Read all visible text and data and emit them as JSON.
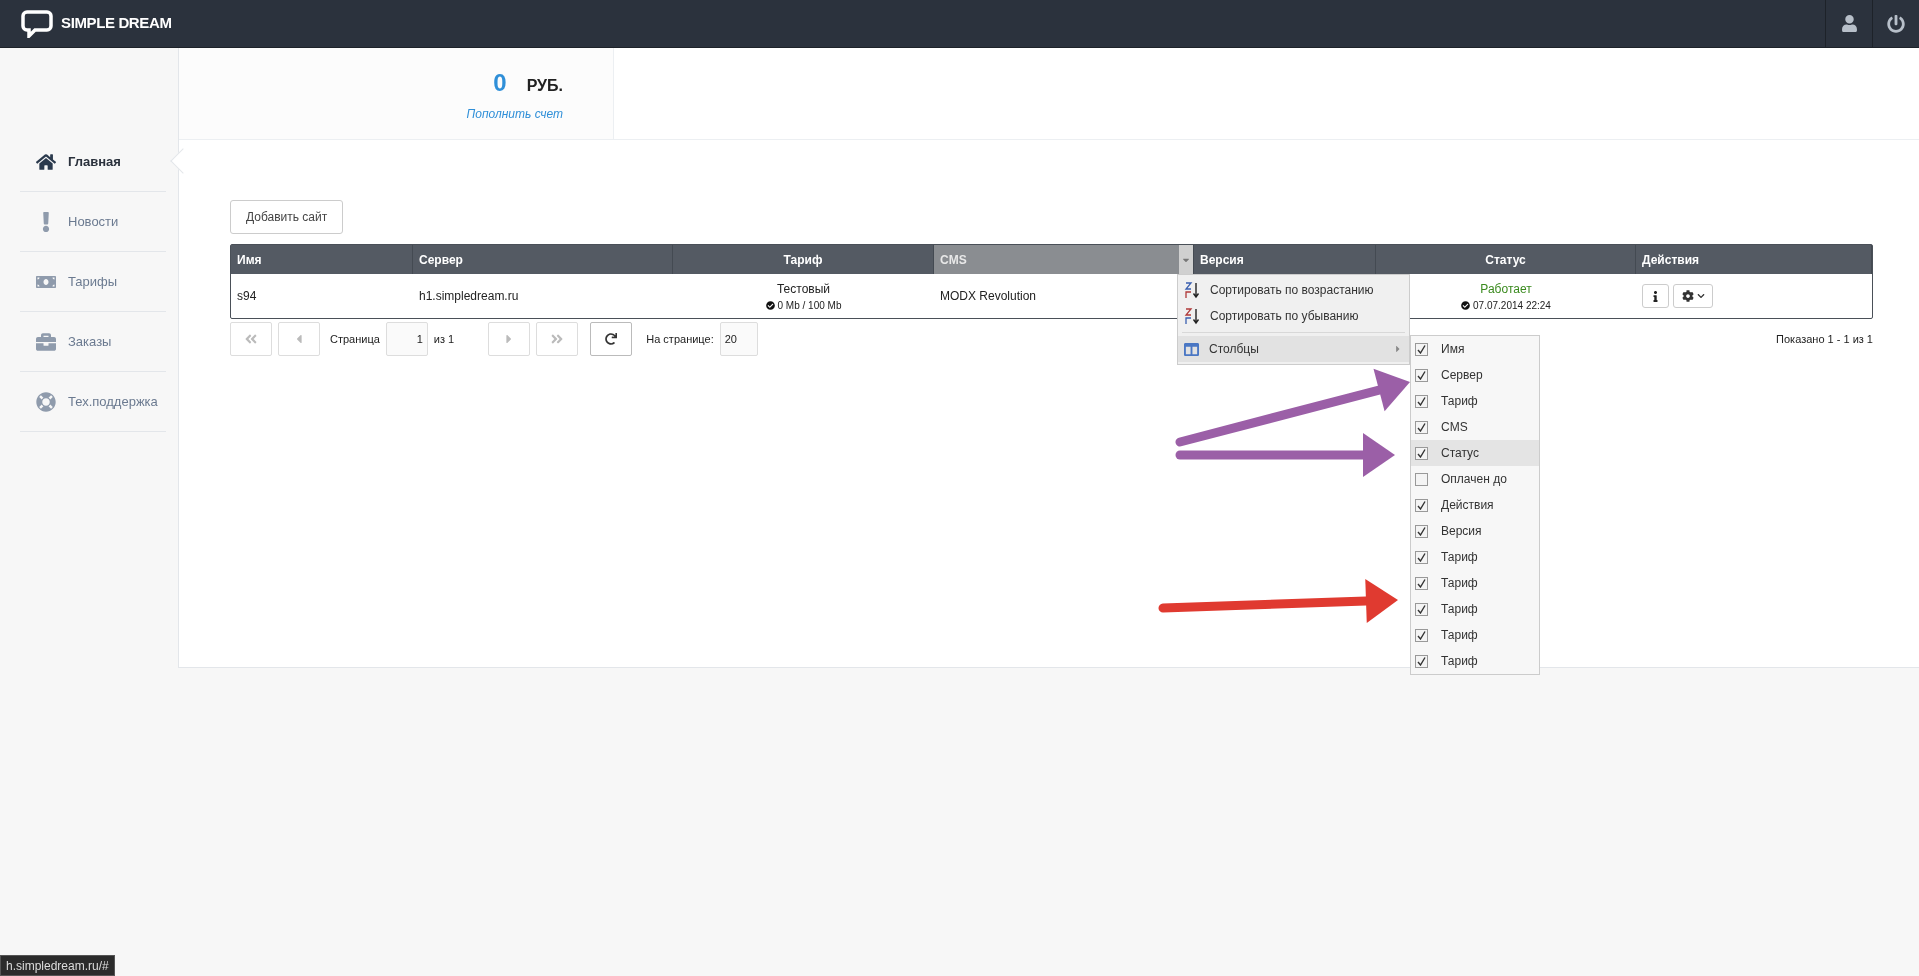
{
  "header": {
    "logo": "SIMPLE DREAM"
  },
  "sidebar": {
    "items": [
      {
        "label": "Главная",
        "selected": true
      },
      {
        "label": "Новости",
        "selected": false
      },
      {
        "label": "Тарифы",
        "selected": false
      },
      {
        "label": "Заказы",
        "selected": false
      },
      {
        "label": "Тех.поддержка",
        "selected": false
      }
    ]
  },
  "balance": {
    "amount": "0",
    "currency": "РУБ.",
    "link": "Пополнить счет"
  },
  "add_button": "Добавить сайт",
  "table": {
    "columns": [
      {
        "label": "Имя",
        "menu_open": false
      },
      {
        "label": "Сервер",
        "menu_open": false
      },
      {
        "label": "Тариф",
        "menu_open": false
      },
      {
        "label": "CMS",
        "menu_open": true
      },
      {
        "label": "Версия",
        "menu_open": false
      },
      {
        "label": "Статус",
        "menu_open": false
      },
      {
        "label": "Действия",
        "menu_open": false
      }
    ],
    "rows": [
      {
        "name": "s94",
        "server": "h1.simpledream.ru",
        "tariff": "Тестовый",
        "quota": "0 Mb / 100 Mb",
        "cms": "MODX Revolution",
        "status": "Работает",
        "status_date": "07.07.2014 22:24"
      }
    ]
  },
  "pager": {
    "page_label": "Страница",
    "page": "1",
    "of": "из 1",
    "per_page_label": "На странице:",
    "per_page": "20",
    "shown": "Показано 1 - 1 из 1"
  },
  "column_menu": {
    "items": [
      {
        "kind": "sort",
        "label": "Сортировать по возрастанию",
        "highlighted": false
      },
      {
        "kind": "sort",
        "label": "Сортировать по убыванию",
        "highlighted": false
      },
      {
        "kind": "submenu",
        "label": "Столбцы",
        "highlighted": true
      }
    ],
    "columns": [
      {
        "label": "Имя",
        "checked": true,
        "highlighted": false
      },
      {
        "label": "Сервер",
        "checked": true,
        "highlighted": false
      },
      {
        "label": "Тариф",
        "checked": true,
        "highlighted": false
      },
      {
        "label": "CMS",
        "checked": true,
        "highlighted": false
      },
      {
        "label": "Статус",
        "checked": true,
        "highlighted": true
      },
      {
        "label": "Оплачен до",
        "checked": false,
        "highlighted": false
      },
      {
        "label": "Действия",
        "checked": true,
        "highlighted": false
      },
      {
        "label": "Версия",
        "checked": true,
        "highlighted": false
      },
      {
        "label": "Тариф",
        "checked": true,
        "highlighted": false
      },
      {
        "label": "Тариф",
        "checked": true,
        "highlighted": false
      },
      {
        "label": "Тариф",
        "checked": true,
        "highlighted": false
      },
      {
        "label": "Тариф",
        "checked": true,
        "highlighted": false
      },
      {
        "label": "Тариф",
        "checked": true,
        "highlighted": false
      }
    ]
  },
  "annotations": [
    {
      "color": "#9b5fa7"
    },
    {
      "color": "#9b5fa7"
    },
    {
      "color": "#e03a30"
    }
  ],
  "status_bar": "h.simpledream.ru/#"
}
